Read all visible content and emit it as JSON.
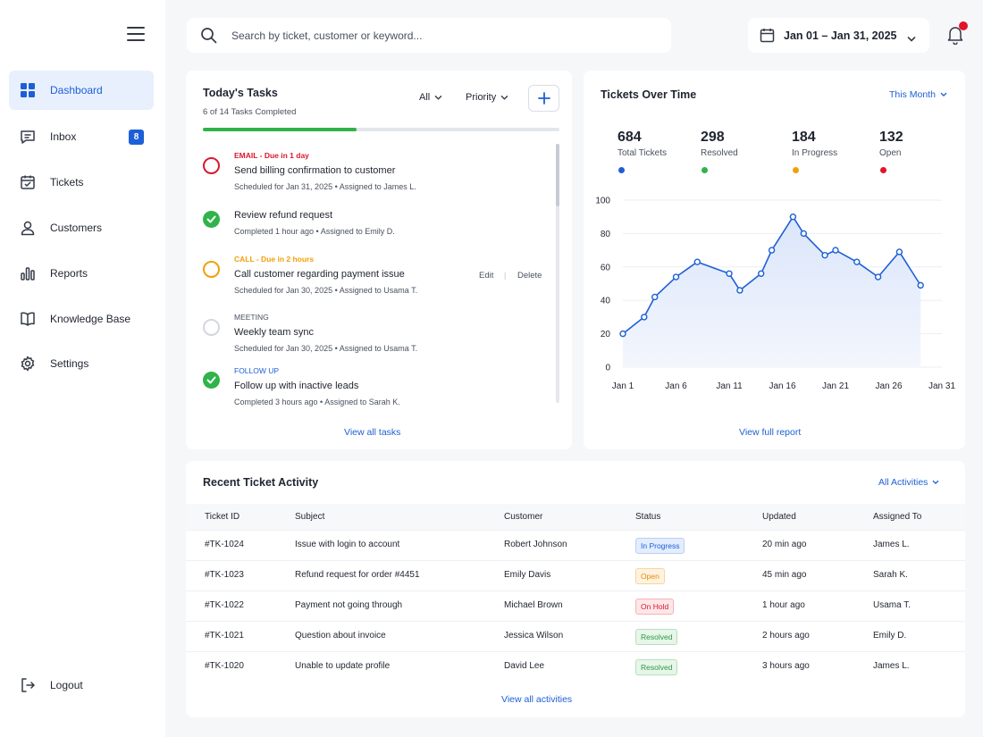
{
  "sidebar": {
    "items": [
      {
        "label": "Dashboard",
        "icon": "dashboard-grid-icon",
        "active": true
      },
      {
        "label": "Inbox",
        "icon": "inbox-icon",
        "badge": "8"
      },
      {
        "label": "Tickets",
        "icon": "calendar-ticket-icon"
      },
      {
        "label": "Customers",
        "icon": "user-icon"
      },
      {
        "label": "Reports",
        "icon": "bar-chart-icon"
      },
      {
        "label": "Knowledge Base",
        "icon": "book-icon"
      },
      {
        "label": "Settings",
        "icon": "gear-icon"
      }
    ],
    "logout": "Logout"
  },
  "header": {
    "search_placeholder": "Search by ticket, customer or keyword...",
    "date_range": "Jan 01 – Jan 31, 2025"
  },
  "tasks": {
    "title": "Today's Tasks",
    "subtitle": "6 of 14 Tasks Completed",
    "progress": 0.43,
    "filter_all": "All",
    "filter_priority": "Priority",
    "view_all": "View all tasks",
    "items": [
      {
        "tag": "EMAIL - Due in 1 day",
        "title": "Send billing confirmation to customer",
        "meta": "Scheduled for Jan 31, 2025   •   Assigned to James L.",
        "state": "urgent"
      },
      {
        "tag": "",
        "title": "Review refund request",
        "meta": "Completed 1 hour ago   •   Assigned to Emily D.",
        "state": "done"
      },
      {
        "tag": "CALL - Due in 2 hours",
        "title": "Call customer regarding payment issue",
        "meta": "Scheduled for Jan 30, 2025   •   Assigned to Usama T.",
        "state": "warning",
        "edit": "Edit",
        "delete": "Delete"
      },
      {
        "tag": "MEETING",
        "title": "Weekly team sync",
        "meta": "Scheduled for Jan 30, 2025   •   Assigned to Usama T.",
        "state": "pending"
      },
      {
        "tag": "FOLLOW UP",
        "title": "Follow up with inactive leads",
        "meta": "Completed 3 hours ago   •   Assigned to Sarah K.",
        "state": "done"
      }
    ]
  },
  "chart": {
    "title": "Tickets Over Time",
    "range_select": "This Month",
    "view_report": "View full report",
    "stats": [
      {
        "value": "684",
        "label": "Total Tickets",
        "color": "#1d5fd6"
      },
      {
        "value": "298",
        "label": "Resolved",
        "color": "#2fb34a"
      },
      {
        "value": "184",
        "label": "In Progress",
        "color": "#f2a007"
      },
      {
        "value": "132",
        "label": "Open",
        "color": "#e0142c"
      }
    ]
  },
  "chart_data": {
    "type": "area",
    "x_tick_labels": [
      "Jan 1",
      "Jan 6",
      "Jan 11",
      "Jan 16",
      "Jan 21",
      "Jan 26",
      "Jan 31"
    ],
    "x_day_ticks": [
      1,
      6,
      11,
      16,
      21,
      26,
      31
    ],
    "y_ticks": [
      0,
      20,
      40,
      60,
      80,
      100
    ],
    "ylim": [
      0,
      100
    ],
    "xlim": [
      1,
      31
    ],
    "series": [
      {
        "color": "#1d5fd6",
        "x": [
          1,
          2,
          3,
          4,
          5,
          6,
          7,
          8,
          9,
          10,
          11,
          12,
          13,
          14,
          15,
          16
        ],
        "points": [
          [
            1,
            20
          ],
          [
            3,
            30
          ],
          [
            4,
            42
          ],
          [
            6,
            54
          ],
          [
            8,
            63
          ],
          [
            11,
            56
          ],
          [
            12,
            46
          ],
          [
            14,
            56
          ],
          [
            15,
            70
          ],
          [
            17,
            90
          ],
          [
            18,
            80
          ],
          [
            20,
            67
          ],
          [
            21,
            70
          ],
          [
            23,
            63
          ],
          [
            25,
            54
          ],
          [
            27,
            69
          ],
          [
            29,
            49
          ]
        ]
      }
    ],
    "grid": true
  },
  "activity": {
    "title": "Recent Ticket Activity",
    "filter": "All Activities",
    "view_all": "View all activities",
    "columns": [
      "Ticket ID",
      "Subject",
      "Customer",
      "Status",
      "Updated",
      "Assigned To"
    ],
    "rows": [
      {
        "id": "#TK-1024",
        "subject": "Issue with login to account",
        "customer": "Robert Johnson",
        "status": "In Progress",
        "status_key": "inprogress",
        "updated": "20 min ago",
        "assigned": "James L."
      },
      {
        "id": "#TK-1023",
        "subject": "Refund request for order #4451",
        "customer": "Emily Davis",
        "status": "Open",
        "status_key": "open",
        "updated": "45 min ago",
        "assigned": "Sarah K."
      },
      {
        "id": "#TK-1022",
        "subject": "Payment not going through",
        "customer": "Michael Brown",
        "status": "On Hold",
        "status_key": "onhold",
        "updated": "1 hour ago",
        "assigned": "Usama T."
      },
      {
        "id": "#TK-1021",
        "subject": "Question about invoice",
        "customer": "Jessica Wilson",
        "status": "Resolved",
        "status_key": "resolved",
        "updated": "2 hours ago",
        "assigned": "Emily D."
      },
      {
        "id": "#TK-1020",
        "subject": "Unable to update profile",
        "customer": "David Lee",
        "status": "Resolved",
        "status_key": "resolved",
        "updated": "3 hours ago",
        "assigned": "James L."
      }
    ]
  }
}
